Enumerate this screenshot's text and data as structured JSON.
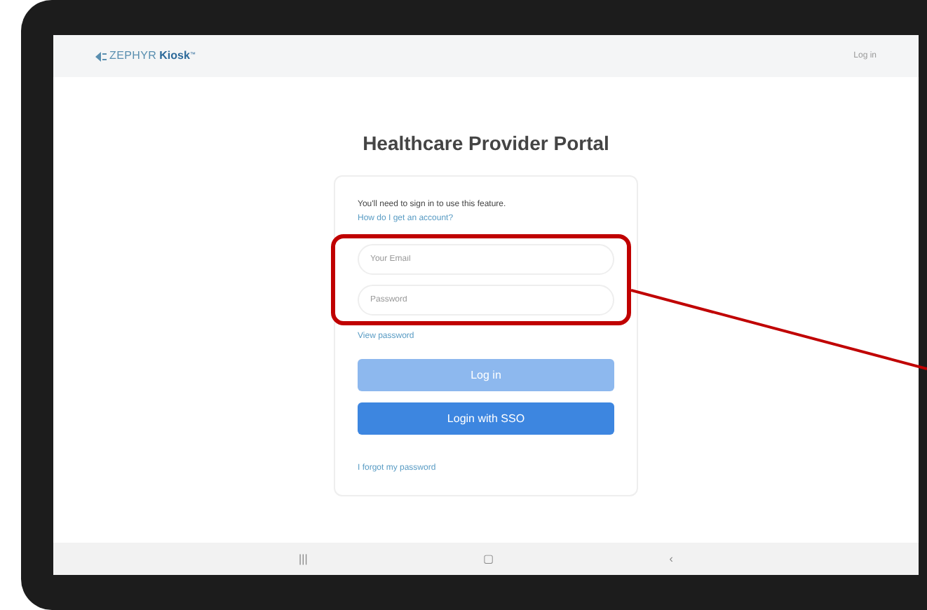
{
  "header": {
    "logo_brand": "ZEPHYR",
    "logo_product": "Kiosk",
    "logo_mark": "™",
    "login_link": "Log in"
  },
  "title": "Healthcare Provider Portal",
  "card": {
    "intro": "You'll need to sign in to use this feature.",
    "account_link": "How do I get an account?",
    "fields": [
      {
        "placeholder": "Your Email"
      },
      {
        "placeholder": "Password"
      }
    ],
    "view_password": "View password",
    "buttons": [
      {
        "label": "Log in",
        "disabled": true
      },
      {
        "label": "Login with SSO",
        "disabled": false
      }
    ],
    "forgot_link": "I forgot my password"
  },
  "nav_bar": [
    "|||",
    "▢",
    "‹"
  ]
}
